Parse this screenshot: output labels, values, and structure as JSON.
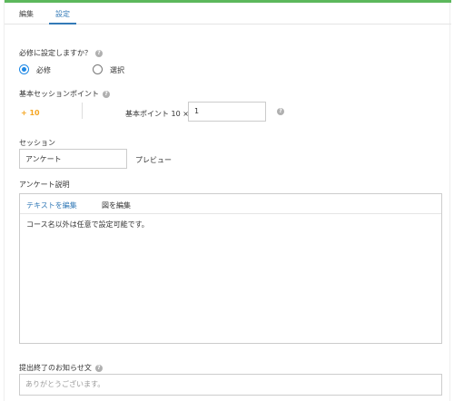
{
  "tabs": {
    "edit": "編集",
    "settings": "設定"
  },
  "required": {
    "label": "必修に設定しますか？",
    "options": [
      "必修",
      "選択"
    ]
  },
  "basic_points": {
    "label": "基本セッションポイント",
    "value": "+ 10",
    "multiplier_label": "基本ポイント 10 ×",
    "multiplier_value": "1"
  },
  "session": {
    "label": "セッション",
    "value": "アンケート",
    "preview_label": "プレビュー"
  },
  "description": {
    "label": "アンケート説明",
    "tabs": [
      "テキストを編集",
      "図を編集"
    ],
    "content": "コース名以外は任意で設定可能です。"
  },
  "completion_notice": {
    "label": "提出終了のお知らせ文",
    "placeholder": "ありがとうございます。"
  },
  "colors": {
    "accent_green": "#5cb85c",
    "accent_blue": "#337ab7",
    "points_orange": "#f5a623",
    "radio_blue": "#1e88e5"
  },
  "icons": [
    "help-icon"
  ]
}
